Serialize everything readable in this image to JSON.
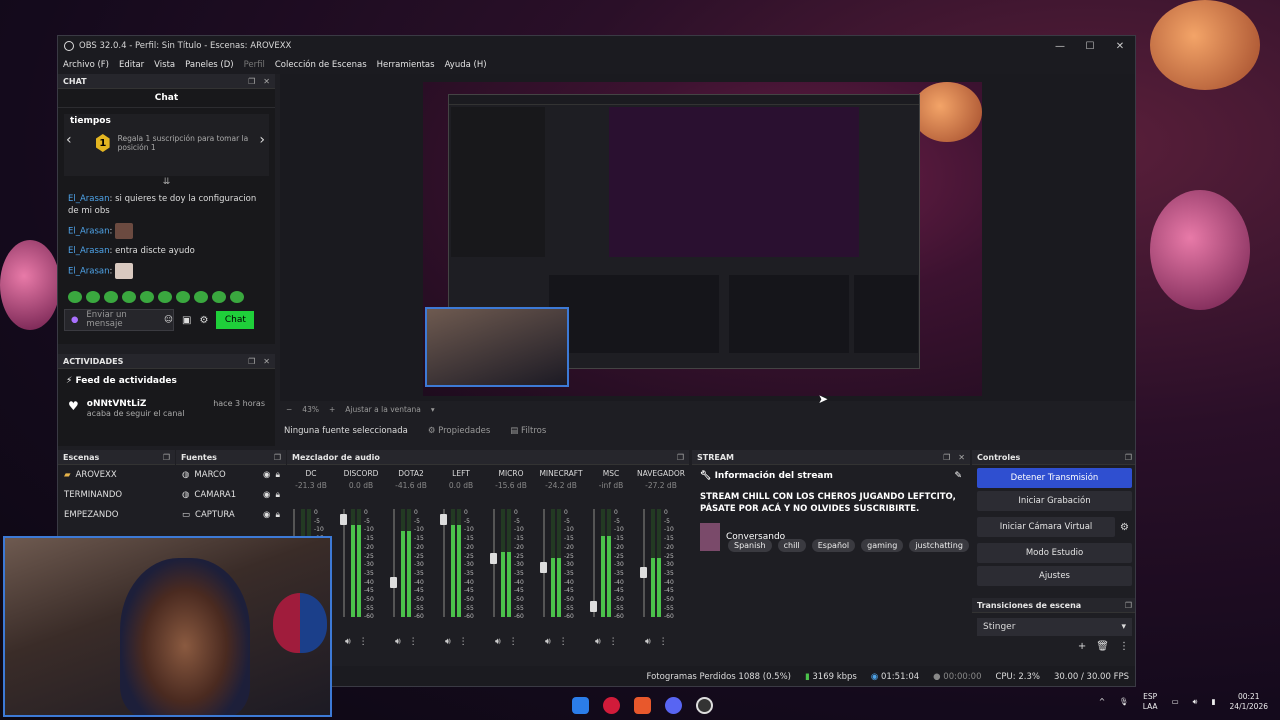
{
  "window": {
    "title": "OBS 32.0.4 - Perfil: Sin Título - Escenas: AROVEXX"
  },
  "menu": [
    "Archivo (F)",
    "Editar",
    "Vista",
    "Paneles (D)",
    "Perfil",
    "Colección de Escenas",
    "Herramientas",
    "Ayuda (H)"
  ],
  "chat": {
    "dock_title": "CHAT",
    "title": "Chat",
    "pin_heading": "tiempos",
    "pin_rank": "1",
    "pin_text": "Regala 1 suscripción para tomar la posición 1",
    "messages": [
      {
        "user": "El_Arasan",
        "text": "si quieres te doy la configuracion de mi obs"
      },
      {
        "user": "El_Arasan",
        "text": ""
      },
      {
        "user": "El_Arasan",
        "text": "entra discte ayudo"
      },
      {
        "user": "El_Arasan",
        "text": ""
      }
    ],
    "input_placeholder": "Enviar un mensaje",
    "send_label": "Chat"
  },
  "activities": {
    "dock_title": "ACTIVIDADES",
    "feed_title": "Feed de actividades",
    "user": "oNNtVNtLiZ",
    "action": "acaba de seguir el canal",
    "time": "hace 3 horas"
  },
  "preview": {
    "zoom": "43%",
    "fit_label": "Ajustar a la ventana"
  },
  "context": {
    "no_source": "Ninguna fuente seleccionada",
    "properties": "Propiedades",
    "filters": "Filtros"
  },
  "scenes": {
    "title": "Escenas",
    "items": [
      "AROVEXX",
      "TERMINANDO",
      "EMPEZANDO"
    ]
  },
  "sources": {
    "title": "Fuentes",
    "items": [
      "MARCO",
      "CAMARA1",
      "CAPTURA"
    ]
  },
  "mixer": {
    "title": "Mezclador de audio",
    "channels": [
      {
        "name": "DC",
        "db": "-21.3 dB",
        "level": 0.3,
        "fader": 0.45
      },
      {
        "name": "DISCORD",
        "db": "0.0 dB",
        "level": 0.85,
        "fader": 0.95
      },
      {
        "name": "DOTA2",
        "db": "-41.6 dB",
        "level": 0.8,
        "fader": 0.3
      },
      {
        "name": "LEFT",
        "db": "0.0 dB",
        "level": 0.85,
        "fader": 0.95
      },
      {
        "name": "MICRO",
        "db": "-15.6 dB",
        "level": 0.6,
        "fader": 0.55
      },
      {
        "name": "MINECRAFT",
        "db": "-24.2 dB",
        "level": 0.55,
        "fader": 0.45
      },
      {
        "name": "MSC",
        "db": "-inf dB",
        "level": 0.75,
        "fader": 0.05
      },
      {
        "name": "NAVEGADOR",
        "db": "-27.2 dB",
        "level": 0.55,
        "fader": 0.4
      }
    ],
    "scale": [
      "0",
      "-5",
      "-10",
      "-15",
      "-20",
      "-25",
      "-30",
      "-35",
      "-40",
      "-45",
      "-50",
      "-55",
      "-60"
    ]
  },
  "stream": {
    "dock_title": "STREAM",
    "header": "Información del stream",
    "title": "STREAM CHILL CON LOS CHEROS JUGANDO LEFTCITO, PÁSATE POR ACÁ Y NO OLVIDES SUSCRIBIRTE.",
    "category": "Conversando",
    "tags": [
      "Spanish",
      "chill",
      "Español",
      "gaming",
      "justchatting"
    ]
  },
  "controls": {
    "title": "Controles",
    "buttons": [
      "Detener Transmisión",
      "Iniciar Grabación",
      "Iniciar Cámara Virtual",
      "Modo Estudio",
      "Ajustes"
    ]
  },
  "transitions": {
    "title": "Transiciones de escena",
    "selected": "Stinger"
  },
  "status": {
    "dropped": "Fotogramas Perdidos 1088 (0.5%)",
    "bitrate": "3169 kbps",
    "stream_time": "01:51:04",
    "rec_time": "00:00:00",
    "cpu": "CPU: 2.3%",
    "fps": "30.00 / 30.00 FPS"
  },
  "tray": {
    "lang1": "ESP",
    "lang2": "LAA",
    "time": "00:21",
    "date": "24/1/2026"
  },
  "colors": {
    "accent": "#2f4fd0",
    "twitch_green": "#1fcf3a",
    "user": "#4ea3e8"
  }
}
